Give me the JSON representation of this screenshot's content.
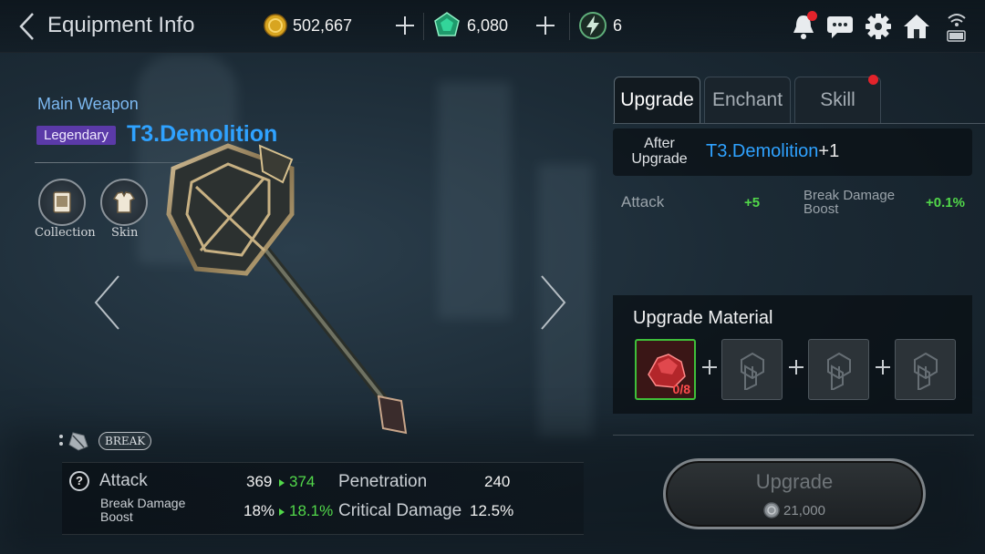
{
  "header": {
    "title": "Equipment Info",
    "gold": "502,667",
    "gems": "6,080",
    "energy": "6"
  },
  "equipment": {
    "slot_label": "Main Weapon",
    "grade": "Legendary",
    "name": "T3.Demolition",
    "buttons": {
      "collection": "Collection",
      "skin": "Skin"
    },
    "break_label": "BREAK"
  },
  "stats": {
    "help": "?",
    "attack_label": "Attack",
    "attack_current": "369",
    "attack_next": "374",
    "break_label": "Break Damage Boost",
    "break_current": "18%",
    "break_next": "18.1%",
    "penetration_label": "Penetration",
    "penetration_value": "240",
    "critical_label": "Critical Damage",
    "critical_value": "12.5%"
  },
  "tabs": [
    {
      "label": "Upgrade",
      "active": true
    },
    {
      "label": "Enchant",
      "active": false
    },
    {
      "label": "Skill",
      "active": false,
      "badge": true
    }
  ],
  "upgrade": {
    "after_label": "After Upgrade",
    "after_name": "T3.Demolition",
    "after_level": "+1",
    "attack_label": "Attack",
    "attack_delta": "+5",
    "break_label": "Break Damage Boost",
    "break_delta": "+0.1%",
    "material_title": "Upgrade Material",
    "material_count": "0/8",
    "button_label": "Upgrade",
    "cost": "21,000"
  },
  "colors": {
    "accent_blue": "#2fa2ff",
    "legendary_purple": "#5b3aa8",
    "increase_green": "#52d84a",
    "notification_red": "#e3232b"
  }
}
